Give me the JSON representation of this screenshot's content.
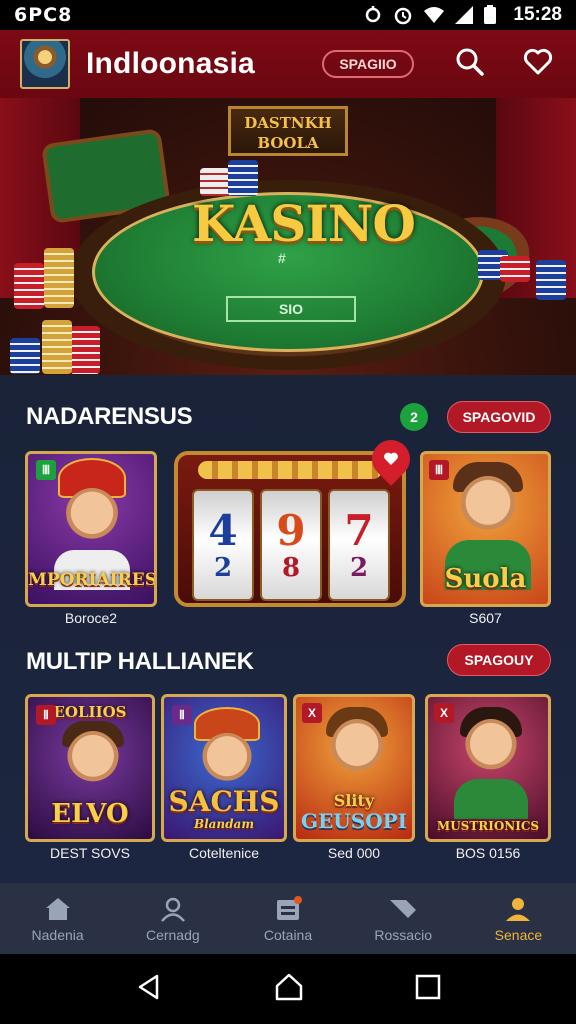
{
  "status_bar": {
    "left_text": "6PC8",
    "time": "15:28"
  },
  "header": {
    "title": "Indloonasia",
    "pill_label": "SPAGIIO"
  },
  "hero": {
    "title": "KASINO",
    "sign_text": "DASTNKH BOOLA",
    "felt_box_label": "SIO",
    "felt_mid_text": "#"
  },
  "section1": {
    "title": "NADARENSUS",
    "badge": "2",
    "button_label": "SPAGOVID",
    "tiles": [
      {
        "art_text": "MPORIAIRES",
        "tag": "Ⅲ",
        "caption": "Boroce2"
      },
      {
        "reels": [
          {
            "top": "4",
            "bottom": "2"
          },
          {
            "top": "9",
            "bottom": "8"
          },
          {
            "top": "7",
            "bottom": "2"
          }
        ]
      },
      {
        "art_text": "Suola",
        "tag": "Ⅲ",
        "caption": "S607"
      }
    ]
  },
  "section2": {
    "title": "MULTIP HALLIANEK",
    "button_label": "SPAGOUY",
    "tiles": [
      {
        "art_top": "EOLIIOS",
        "art_text": "ELVO",
        "tag": "Ⅱ",
        "caption": "DEST SOVS"
      },
      {
        "art_text": "SACHS",
        "art_sub": "Blandam",
        "tag": "Ⅱ",
        "caption": "Coteltenice"
      },
      {
        "art_text": "Slity",
        "art_sub": "GEUSOPI",
        "tag": "X",
        "caption": "Sed 000"
      },
      {
        "art_text": "MUSTRIONICS",
        "tag": "X",
        "caption": "BOS 0156"
      }
    ]
  },
  "bottom_nav": {
    "items": [
      {
        "label": "Nadenia",
        "icon": "home-icon"
      },
      {
        "label": "Cernadg",
        "icon": "person-icon"
      },
      {
        "label": "Cotaina",
        "icon": "briefcase-icon"
      },
      {
        "label": "Rossacio",
        "icon": "ticket-icon"
      },
      {
        "label": "Senace",
        "icon": "profile-icon"
      }
    ]
  },
  "colors": {
    "accent_red": "#b21825",
    "gold": "#f0b43c",
    "bg_dark": "#1a2338"
  }
}
